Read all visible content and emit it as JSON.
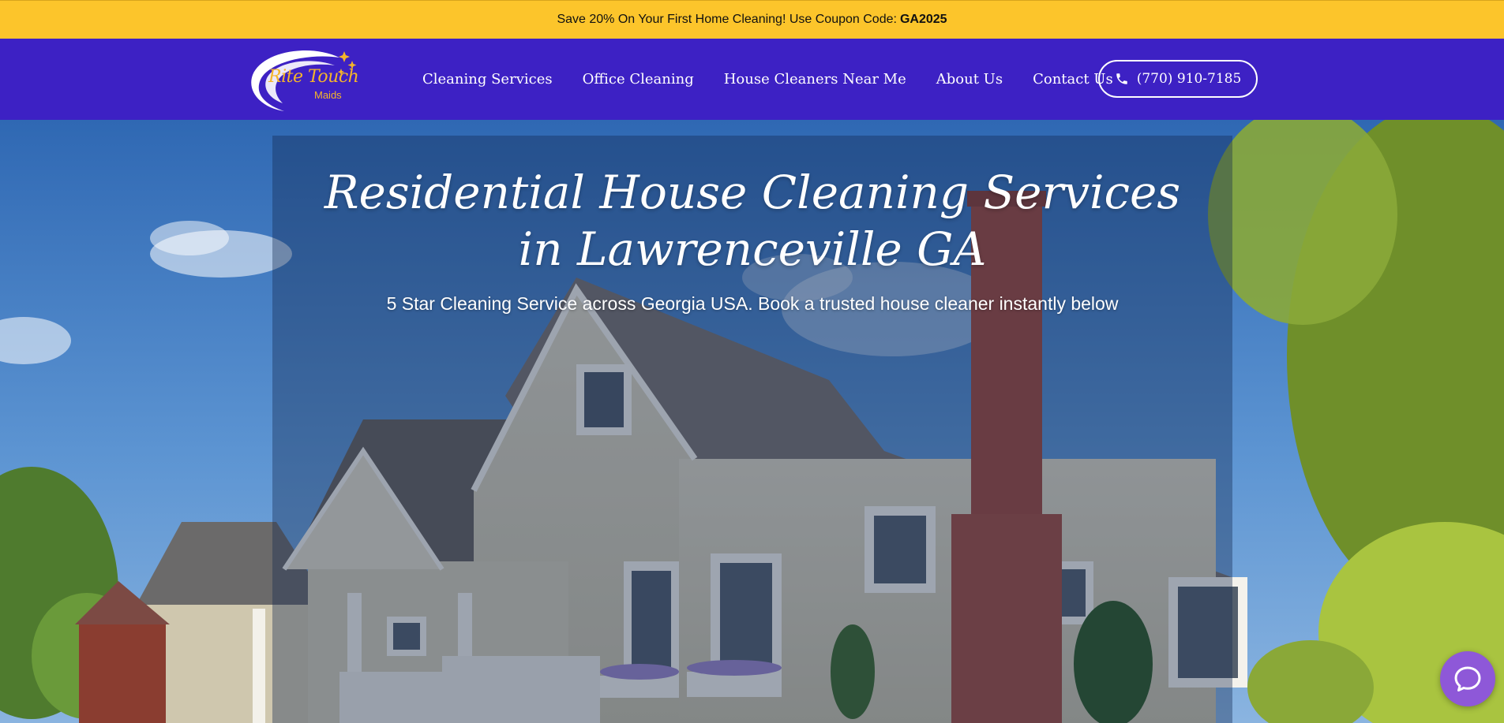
{
  "promo": {
    "text": "Save 20% On Your First Home Cleaning! Use Coupon Code:",
    "code": "GA2025"
  },
  "logo": {
    "name": "Rite Touch",
    "sub": "Maids"
  },
  "nav": {
    "items": [
      {
        "label": "Cleaning Services"
      },
      {
        "label": "Office Cleaning"
      },
      {
        "label": "House Cleaners Near Me"
      },
      {
        "label": "About Us"
      },
      {
        "label": "Contact Us"
      }
    ],
    "phone": "(770) 910-7185",
    "phone_icon": "phone-icon"
  },
  "hero": {
    "title_line1": "Residential House Cleaning Services",
    "title_line2": "in Lawrenceville GA",
    "subtitle": "5 Star Cleaning Service across Georgia USA. Book a trusted house cleaner instantly below",
    "image": "house-photo"
  },
  "chat": {
    "icon": "chat-bubble-icon"
  },
  "colors": {
    "promo_bg": "#fcc52b",
    "header_bg": "#3d21c4",
    "logo_accent": "#f5b52a",
    "chat_bg": "#8e58d8"
  }
}
